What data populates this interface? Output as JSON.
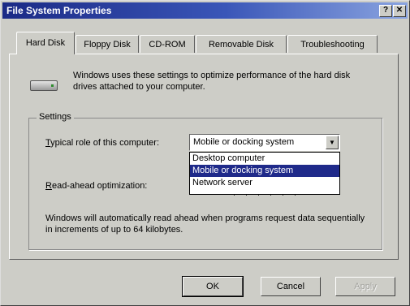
{
  "window": {
    "title": "File System Properties",
    "help_button": "?",
    "close_button": "✕"
  },
  "tabs": [
    {
      "label": "Hard Disk",
      "active": true
    },
    {
      "label": "Floppy Disk"
    },
    {
      "label": "CD-ROM"
    },
    {
      "label": "Removable Disk"
    },
    {
      "label": "Troubleshooting"
    }
  ],
  "panel": {
    "intro": "Windows uses these settings to optimize performance of the hard disk drives attached to your computer.",
    "settings": {
      "group_label": "Settings",
      "typical_role": {
        "label_accel": "T",
        "label_rest": "ypical role of this computer:",
        "value": "Mobile or docking system",
        "options": [
          "Desktop computer",
          "Mobile or docking system",
          "Network server"
        ],
        "selected_index": 1
      },
      "read_ahead": {
        "label_accel": "R",
        "label_rest": "ead-ahead optimization:"
      },
      "description": "Windows will automatically read ahead when programs request data sequentially in increments of up to 64 kilobytes."
    }
  },
  "buttons": {
    "ok": "OK",
    "cancel": "Cancel",
    "apply": "Apply"
  },
  "icons": {
    "drive": "hard-disk-drive-icon",
    "dropdown": "chevron-down-icon"
  }
}
